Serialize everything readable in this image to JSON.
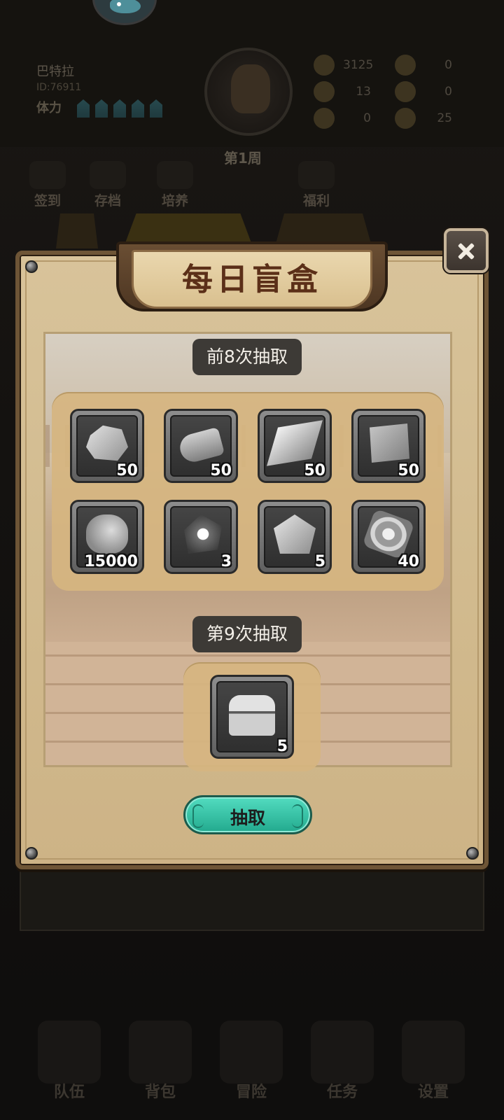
{
  "background": {
    "player": {
      "name": "巴特拉",
      "id": "ID:76911",
      "stamina_label": "体力"
    },
    "week_label": "第1周",
    "resources": [
      "3125",
      "0",
      "13",
      "0",
      "0",
      "25"
    ],
    "menu": [
      "签到",
      "存档",
      "培养",
      "福利"
    ],
    "bottom_nav": [
      "队伍",
      "背包",
      "冒险",
      "任务",
      "设置"
    ]
  },
  "dialog": {
    "title": "每日盲盒",
    "first_section_label": "前8次抽取",
    "first_rewards": [
      {
        "icon": "ore-icon",
        "qty": "50"
      },
      {
        "icon": "log-icon",
        "qty": "50"
      },
      {
        "icon": "plank-icon",
        "qty": "50"
      },
      {
        "icon": "cloth-icon",
        "qty": "50"
      },
      {
        "icon": "coin-bag-icon",
        "qty": "15000"
      },
      {
        "icon": "fire-stone-icon",
        "qty": "3"
      },
      {
        "icon": "rune-stone-icon",
        "qty": "5"
      },
      {
        "icon": "token-icon",
        "qty": "40"
      }
    ],
    "ninth_section_label": "第9次抽取",
    "ninth_reward": {
      "icon": "treasure-chest-icon",
      "qty": "5"
    },
    "draw_button": "抽取"
  }
}
